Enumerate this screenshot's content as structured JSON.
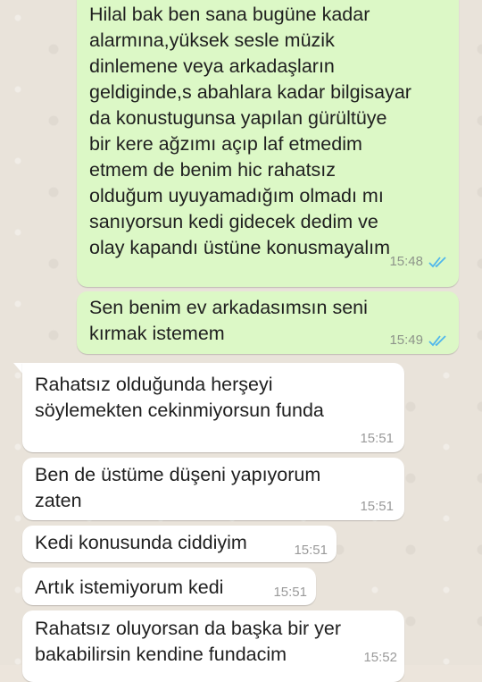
{
  "colors": {
    "outgoing_bubble": "#dcf8c6",
    "incoming_bubble": "#ffffff",
    "read_ticks": "#4fb6ec",
    "wallpaper": "#ece5dc"
  },
  "messages": [
    {
      "direction": "out",
      "text": "Hilal bak ben sana bugüne kadar\nalarmına,yüksek sesle müzik\ndinlemene veya arkadaşların\ngeldiginde,s abahlara kadar bilgisayar\nda konustugunsa yapılan gürültüye\nbir kere ağzımı açıp laf etmedim\netmem de benim hic rahatsız\nolduğum uyuyamadığım olmadı mı\nsanıyorsun kedi gidecek dedim ve\nolay kapandı üstüne konusmayalım",
      "time": "15:48",
      "status_icon": "double-check-read-icon"
    },
    {
      "direction": "out",
      "text": "Sen benim ev arkadasımsın seni\nkırmak istemem",
      "time": "15:49",
      "status_icon": "double-check-read-icon"
    },
    {
      "direction": "in",
      "text": "Rahatsız olduğunda herşeyi\nsöylemekten cekinmiyorsun funda",
      "time": "15:51"
    },
    {
      "direction": "in",
      "text": "Ben de üstüme düşeni yapıyorum\nzaten",
      "time": "15:51"
    },
    {
      "direction": "in",
      "text": "Kedi konusunda ciddiyim",
      "time": "15:51"
    },
    {
      "direction": "in",
      "text": "Artık istemiyorum kedi",
      "time": "15:51"
    },
    {
      "direction": "in",
      "text": "Rahatsız oluyorsan da başka bir yer\nbakabilirsin kendine fundacim",
      "time": "15:52"
    }
  ]
}
